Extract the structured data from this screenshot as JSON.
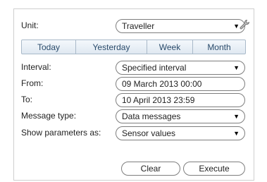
{
  "unit": {
    "label": "Unit:",
    "value": "Traveller"
  },
  "tabs": [
    "Today",
    "Yesterday",
    "Week",
    "Month"
  ],
  "interval": {
    "label": "Interval:",
    "value": "Specified interval"
  },
  "from": {
    "label": "From:",
    "value": "09 March 2013 00:00"
  },
  "to": {
    "label": "To:",
    "value": "10 April 2013 23:59"
  },
  "message_type": {
    "label": "Message type:",
    "value": "Data messages"
  },
  "show_params": {
    "label": "Show parameters as:",
    "value": "Sensor values"
  },
  "buttons": {
    "clear": "Clear",
    "execute": "Execute"
  },
  "icons": {
    "dropdown": "▼",
    "settings": "wrench-icon"
  }
}
